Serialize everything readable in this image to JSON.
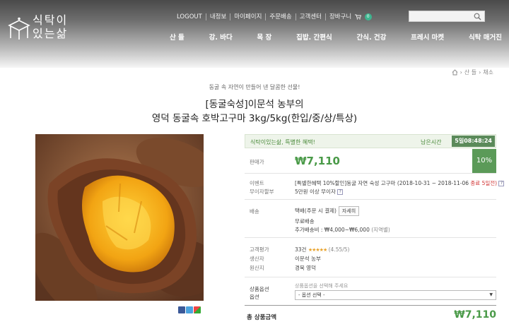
{
  "brand": {
    "logo_line1": "식탁이",
    "logo_line2": "있는삶"
  },
  "topnav": {
    "logout": "LOGOUT",
    "myinfo": "내정보",
    "mypage": "마이페이지",
    "orders": "주문배송",
    "support": "고객센터",
    "cart": "장바구니",
    "cart_count": "0"
  },
  "search": {
    "value": "",
    "placeholder": ""
  },
  "mainnav": [
    "산 들",
    "강. 바다",
    "목 장",
    "집밥. 간편식",
    "간식. 건강",
    "프레시 마켓",
    "식탁 매거진"
  ],
  "breadcrumb": [
    "산 들",
    "채소"
  ],
  "product": {
    "subtitle": "동굴 속 자연이 만들어 낸 달콤한 선물!",
    "title_line1": "[동굴숙성]이문석 농부의",
    "title_line2": "영덕 동굴속 호박고구마 3kg/5kg(한입/중/상/특상)"
  },
  "panel": {
    "promo_text": "식탁이있는삶, 특별한 혜택!",
    "remain_label": "남은시간",
    "timer": "5일08:48:24",
    "price_label": "판매가",
    "price": "₩7,110",
    "discount": "10%",
    "event_label": "이벤트",
    "event_text": "[특별한혜택 10%할인]동굴 자연 숙성 고구마 (2018-10-31 ~ 2018-11-06",
    "event_ended": "종료 5일전)",
    "interest_label": "무이자할부",
    "interest_text": "5만원 이상 무이자",
    "shipping_label": "배송",
    "shipping_type": "택배(주문 시 결제)",
    "shipping_detail_btn": "자세히",
    "shipping_free": "무료배송",
    "shipping_extra": "추가배송비 : ₩4,000~₩6,000",
    "shipping_region": "(지역별)",
    "review_label": "고객평가",
    "review_count": "33건",
    "review_stars": "★★★★★",
    "review_score": "(4.55/5)",
    "producer_label": "생산자",
    "producer": "이문석 농부",
    "origin_label": "원산지",
    "origin": "경북 영덕",
    "option_label1": "상품옵션",
    "option_label2": "옵션",
    "option_hint": "상품옵션을 선택해 주세요",
    "option_selected": "- 옵션 선택 -",
    "total_label": "총 상품금액",
    "total": "₩7,110"
  },
  "colors": {
    "accent_green": "#4a9a48",
    "timer_bg": "#5b8a5a",
    "event_red": "#d03030"
  }
}
